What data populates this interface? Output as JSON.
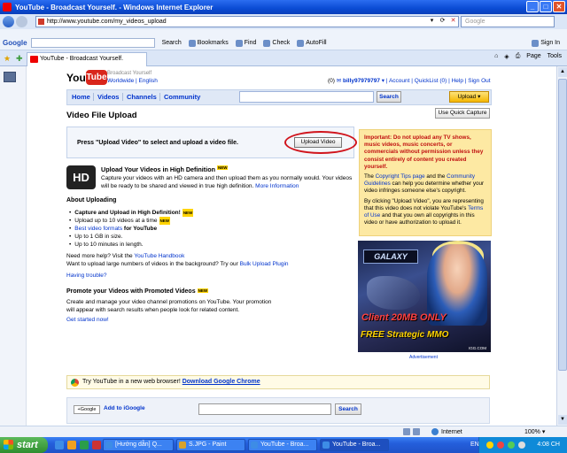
{
  "window": {
    "title": "YouTube - Broadcast Yourself. - Windows Internet Explorer"
  },
  "address": {
    "url": "http://www.youtube.com/my_videos_upload",
    "search_placeholder": "Google"
  },
  "google_toolbar": {
    "logo": "Google",
    "search": "Search",
    "bookmarks": "Bookmarks",
    "find": "Find",
    "check": "Check",
    "autofill": "AutoFill",
    "signin": "Sign In"
  },
  "tab": {
    "title": "YouTube - Broadcast Yourself."
  },
  "ie_tools": {
    "page": "Page",
    "tools": "Tools"
  },
  "header": {
    "tagline": "Broadcast Yourself",
    "lang_worldwide": "Worldwide",
    "lang_english": "English",
    "msg_count": "(0)",
    "username": "billy97979797",
    "account": "Account",
    "quicklist": "QuickList (0)",
    "help": "Help",
    "signout": "Sign Out"
  },
  "nav": {
    "home": "Home",
    "videos": "Videos",
    "channels": "Channels",
    "community": "Community",
    "search_btn": "Search",
    "upload_btn": "Upload"
  },
  "page": {
    "title": "Video File Upload",
    "quick_capture": "Use Quick Capture",
    "upload_prompt": "Press \"Upload Video\" to select and upload a video file.",
    "upload_button": "Upload Video",
    "hd_title": "Upload Your Videos in High Definition",
    "hd_desc": "Capture your videos with an HD camera and then upload them as you normally would. Your videos will be ready to be shared and viewed in true high definition.",
    "hd_more": "More Information",
    "about_title": "About Uploading",
    "bullets": [
      "Capture and Upload in High Definition!",
      "Upload up to 10 videos at a time",
      "Best video formats",
      "for YouTube",
      "Up to 1 GB in size.",
      "Up to 10 minutes in length."
    ],
    "need_help": "Need more help? Visit the",
    "handbook": "YouTube Handbook",
    "want_upload": "Want to upload large numbers of videos in the background? Try our",
    "bulk_plugin": "Bulk Upload Plugin",
    "having_trouble": "Having trouble?",
    "promote_title": "Promote your Videos with Promoted Videos",
    "promote_desc": "Create and manage your video channel promotions on YouTube. Your promotion will appear with search results when people look for related content.",
    "get_started": "Get started now!",
    "new_badge": "NEW"
  },
  "sidebar": {
    "warning_bold": "Important: Do not upload any TV shows, music videos, music concerts, or commercials without permission unless they consist entirely of content you created yourself.",
    "copyright_pre": "The",
    "copyright_link": "Copyright Tips page",
    "and": "and the",
    "community_link": "Community Guidelines",
    "copyright_post": "can help you determine whether your video infringes someone else's copyright.",
    "by_clicking": "By clicking \"Upload Video\", you are representing that this video does not violate YouTube's",
    "terms_link": "Terms of Use",
    "terms_post": "and that you own all copyrights in this video or have authorization to upload it.",
    "ad_game": "GALAXY",
    "ad_client": "Client 20MB ONLY",
    "ad_free": "FREE",
    "ad_mmo": "Strategic MMO",
    "ad_igg": "IGG.COM",
    "ad_label": "Advertisement"
  },
  "chrome_bar": {
    "text": "Try YouTube in a new web browser!",
    "link": "Download Google Chrome"
  },
  "igoogle": {
    "badge": "+Google",
    "link": "Add to iGoogle",
    "button": "Search"
  },
  "status": {
    "zone": "Internet",
    "zoom": "100%"
  },
  "taskbar": {
    "start": "start",
    "items": [
      "[Hướng dẫn] Q...",
      "S.JPG - Paint",
      "YouTube - Broa...",
      "YouTube - Broa..."
    ],
    "lang": "EN",
    "time": "4:08 CH"
  }
}
